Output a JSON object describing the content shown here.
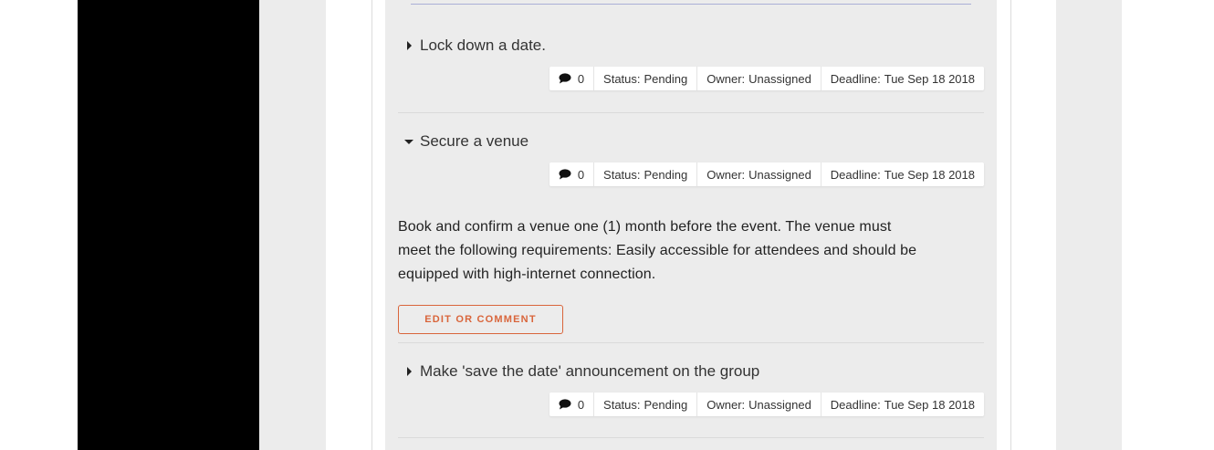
{
  "tasks": [
    {
      "name": "Lock down a date.",
      "expanded": false,
      "comments": "0",
      "status_label": "Status:",
      "status": "Pending",
      "owner_label": "Owner:",
      "owner": "Unassigned",
      "deadline_label": "Deadline:",
      "deadline": "Tue Sep 18 2018"
    },
    {
      "name": "Secure a venue",
      "expanded": true,
      "comments": "0",
      "status_label": "Status:",
      "status": "Pending",
      "owner_label": "Owner:",
      "owner": "Unassigned",
      "deadline_label": "Deadline:",
      "deadline": "Tue Sep 18 2018",
      "description_lines": [
        "Book and confirm a venue one (1) month before the event. The venue must",
        "meet the following requirements: Easily accessible for attendees and should be",
        "equipped with high-internet connection."
      ],
      "edit_label": "EDIT OR COMMENT"
    },
    {
      "name": "Make 'save the date' announcement on the group",
      "expanded": false,
      "comments": "0",
      "status_label": "Status:",
      "status": "Pending",
      "owner_label": "Owner:",
      "owner": "Unassigned",
      "deadline_label": "Deadline:",
      "deadline": "Tue Sep 18 2018"
    }
  ],
  "colors": {
    "accent": "#d9653b",
    "panel_bg": "#ececec",
    "sidebar_black": "#000000",
    "top_rule": "#aab0d6"
  },
  "icons": {
    "comment": "comment-icon",
    "collapsed": "caret-right-icon",
    "expanded": "caret-down-icon"
  }
}
